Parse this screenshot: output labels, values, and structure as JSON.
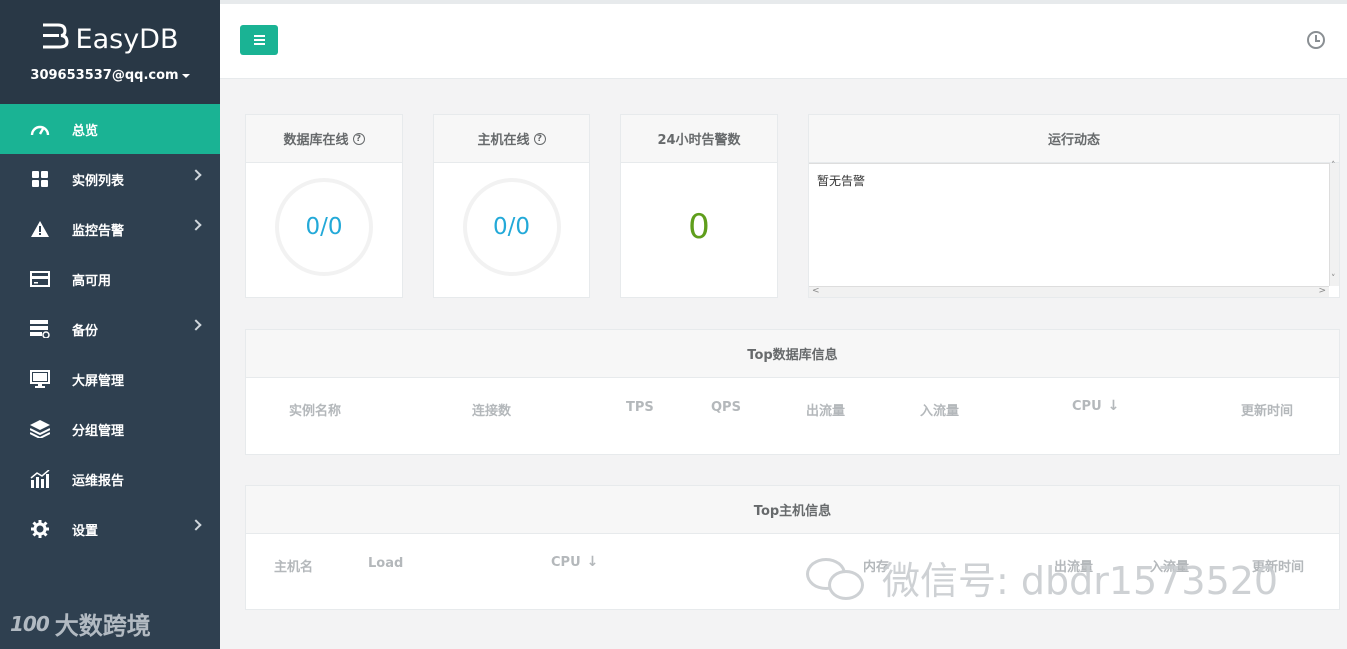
{
  "app": {
    "logo_mark": "Ȣ",
    "logo_text": "EasyDB",
    "user_email": "309653537@qq.com"
  },
  "sidebar": {
    "items": [
      {
        "label": "总览",
        "icon": "dashboard-icon"
      },
      {
        "label": "实例列表",
        "icon": "grid-icon"
      },
      {
        "label": "监控告警",
        "icon": "warning-icon"
      },
      {
        "label": "高可用",
        "icon": "card-icon"
      },
      {
        "label": "备份",
        "icon": "server-icon"
      },
      {
        "label": "大屏管理",
        "icon": "monitor-icon"
      },
      {
        "label": "分组管理",
        "icon": "layers-icon"
      },
      {
        "label": "运维报告",
        "icon": "bar-chart-icon"
      },
      {
        "label": "设置",
        "icon": "gear-icon"
      }
    ]
  },
  "stats": {
    "db_online": {
      "title": "数据库在线",
      "value": "0/0"
    },
    "host_online": {
      "title": "主机在线",
      "value": "0/0"
    },
    "alerts_24h": {
      "title": "24小时告警数",
      "value": "0"
    }
  },
  "activity": {
    "title": "运行动态",
    "content": "暂无告警"
  },
  "top_db": {
    "title": "Top数据库信息",
    "columns": [
      "实例名称",
      "连接数",
      "TPS",
      "QPS",
      "出流量",
      "入流量",
      "CPU",
      "更新时间"
    ]
  },
  "top_host": {
    "title": "Top主机信息",
    "columns": [
      "主机名",
      "Load",
      "CPU",
      "内存",
      "出流量",
      "入流量",
      "更新时间"
    ]
  },
  "watermarks": {
    "left": "大数跨境",
    "left_logo": "100",
    "right": "微信号: dbdr1573520"
  },
  "colors": {
    "sidebar": "#2f4050",
    "accent": "#1ab394",
    "gauge_text": "#23a9d8",
    "alert_count": "#5f9e1c"
  }
}
